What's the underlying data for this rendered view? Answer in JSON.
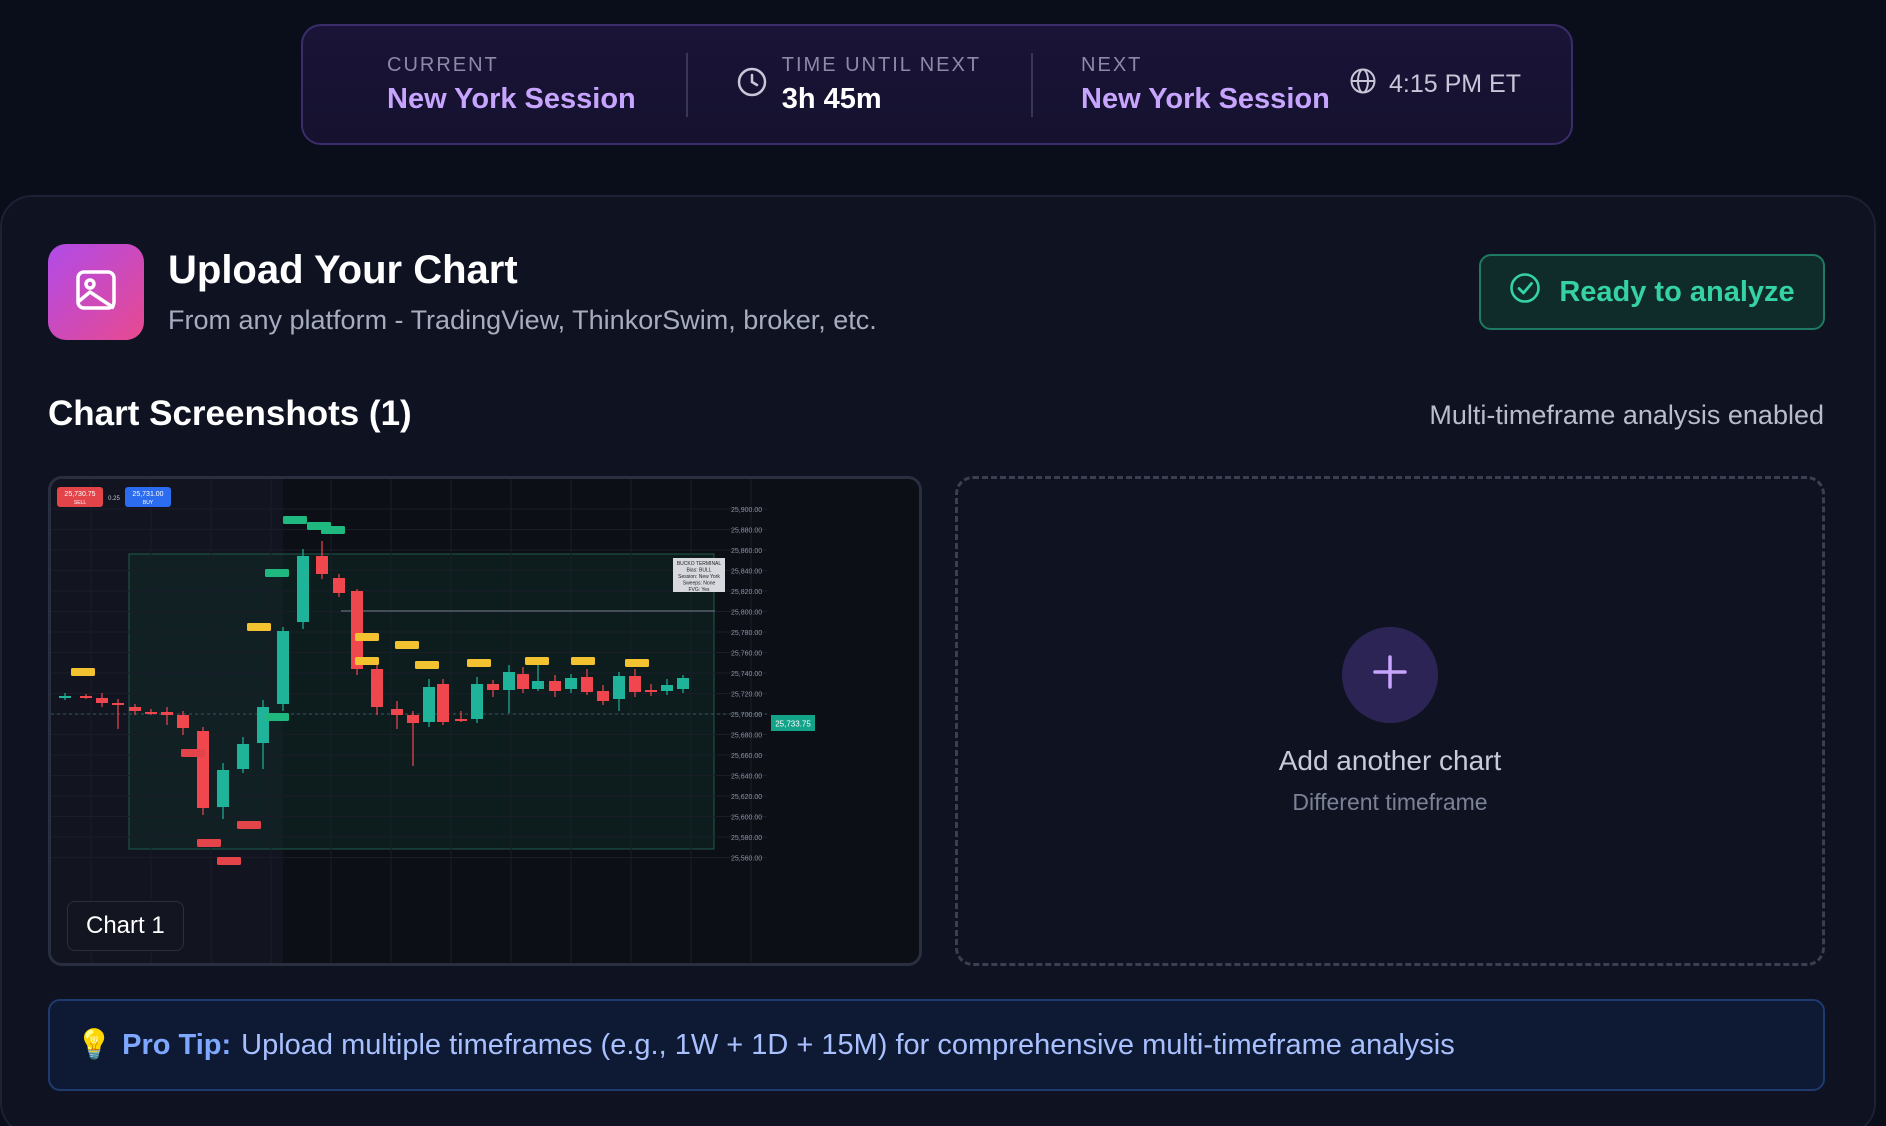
{
  "session": {
    "current_label": "CURRENT",
    "current_value": "New York Session",
    "time_label": "TIME UNTIL NEXT",
    "time_value": "3h 45m",
    "next_label": "NEXT",
    "next_value": "New York Session",
    "time_zone_display": "4:15 PM ET"
  },
  "upload": {
    "title": "Upload Your Chart",
    "subtitle": "From any platform - TradingView, ThinkorSwim, broker, etc.",
    "status_button": "Ready to analyze"
  },
  "screenshots": {
    "title": "Chart Screenshots (1)",
    "note": "Multi-timeframe analysis enabled",
    "items": [
      {
        "label": "Chart 1",
        "sell_price": "25,730.75",
        "sell_label": "SELL",
        "spread": "0.25",
        "buy_price": "25,731.00",
        "buy_label": "BUY",
        "current_price_tag": "25,733.75",
        "price_ticks": [
          "25,900.00",
          "25,880.00",
          "25,860.00",
          "25,840.00",
          "25,820.00",
          "25,800.00",
          "25,780.00",
          "25,760.00",
          "25,740.00",
          "25,720.00",
          "25,700.00",
          "25,680.00",
          "25,660.00",
          "25,640.00",
          "25,620.00",
          "25,600.00",
          "25,580.00",
          "25,560.00"
        ],
        "info_box": [
          "BUCKO TERMINAL",
          "Bias: BULL",
          "Session: New York",
          "Sweeps: None",
          "FVG: Yes"
        ]
      }
    ],
    "add_card": {
      "title": "Add another chart",
      "subtitle": "Different timeframe"
    }
  },
  "protip": {
    "bulb": "💡",
    "label": "Pro Tip:",
    "text": "Upload multiple timeframes (e.g., 1W + 1D + 15M) for comprehensive multi-timeframe analysis"
  },
  "colors": {
    "accent_purple": "#c7a5ff",
    "ready_green": "#35d3a3",
    "candle_up": "#1fb39a",
    "candle_down": "#f0474f",
    "tip_blue": "#7ea8ff"
  },
  "icons": [
    "clock-icon",
    "globe-icon",
    "image-icon",
    "check-circle-icon",
    "plus-icon",
    "lightbulb-icon"
  ]
}
